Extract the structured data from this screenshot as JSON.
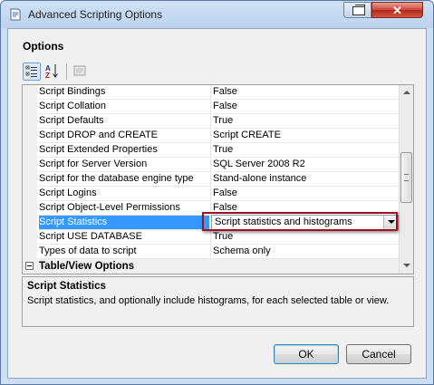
{
  "window": {
    "title": "Advanced Scripting Options",
    "close_glyph": "✕"
  },
  "header": {
    "section_title": "Options"
  },
  "toolbar": {
    "categorized_icon": "categorized-icon",
    "alphabetical_icon": "alphabetical-icon",
    "property_pages_icon": "property-pages-icon"
  },
  "grid": {
    "rows": [
      {
        "name": "Script Bindings",
        "value": "False"
      },
      {
        "name": "Script Collation",
        "value": "False"
      },
      {
        "name": "Script Defaults",
        "value": "True"
      },
      {
        "name": "Script DROP and CREATE",
        "value": "Script CREATE"
      },
      {
        "name": "Script Extended Properties",
        "value": "True"
      },
      {
        "name": "Script for Server Version",
        "value": "SQL Server 2008 R2"
      },
      {
        "name": "Script for the database engine type",
        "value": "Stand-alone instance"
      },
      {
        "name": "Script Logins",
        "value": "False"
      },
      {
        "name": "Script Object-Level Permissions",
        "value": "False"
      },
      {
        "name": "Script Statistics",
        "value": "Script statistics and histograms"
      },
      {
        "name": "Script USE DATABASE",
        "value": "True"
      },
      {
        "name": "Types of data to script",
        "value": "Schema only"
      }
    ],
    "selected_index": 9,
    "category": "Table/View Options"
  },
  "description": {
    "title": "Script Statistics",
    "text": "Script statistics, and optionally include histograms, for each selected table or view."
  },
  "buttons": {
    "ok": "OK",
    "cancel": "Cancel"
  },
  "colors": {
    "selection": "#3399ff",
    "highlight_border": "#a01020"
  }
}
